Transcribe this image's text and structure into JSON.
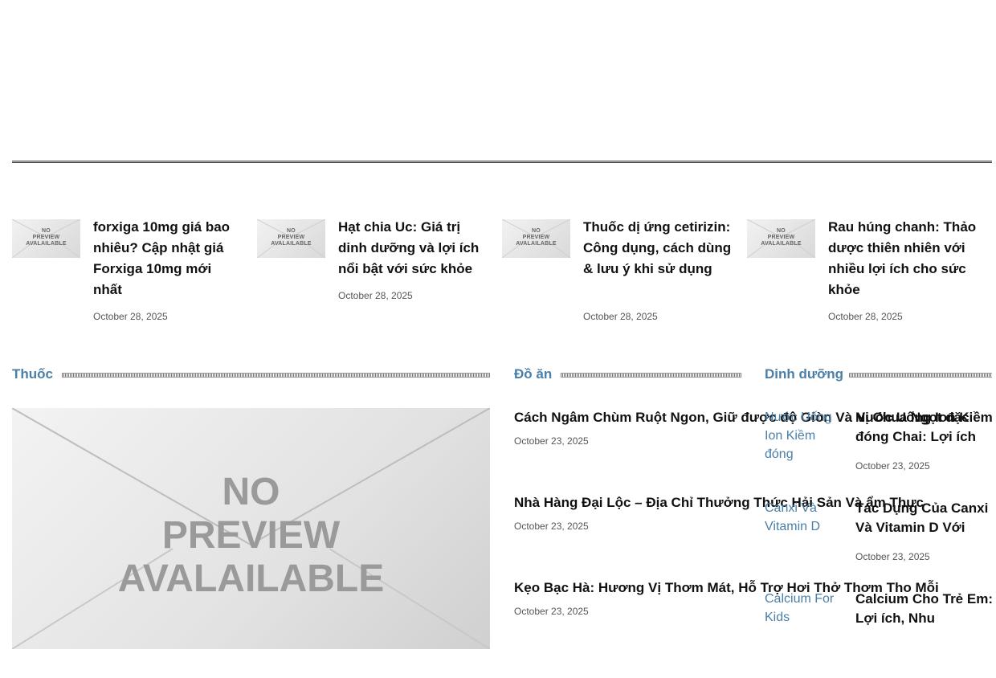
{
  "thumb_text": "NO PREVIEW AVALAILABLE",
  "big_image_text": "NO PREVIEW AVALAILABLE",
  "top_articles": [
    {
      "title": "forxiga 10mg giá bao nhiêu? Cập nhật giá Forxiga 10mg mới nhất",
      "date": "October 28, 2025"
    },
    {
      "title": "Hạt chia Uc: Giá trị dinh dưỡng và lợi ích nổi bật với sức khỏe",
      "date": "October 28, 2025"
    },
    {
      "title": "Thuốc dị ứng cetirizin: Công dụng, cách dùng & lưu ý khi sử dụng",
      "date": "October 28, 2025"
    },
    {
      "title": "Rau húng chanh: Thảo dược thiên nhiên với nhiều lợi ích cho sức khỏe",
      "date": "October 28, 2025"
    }
  ],
  "sections": {
    "thuoc": {
      "title": "Thuốc"
    },
    "do_an": {
      "title": "Đồ ăn"
    },
    "dinh_duong": {
      "title": "Dinh dưỡng"
    }
  },
  "do_an_articles": [
    {
      "title": "Cách Ngâm Chùm Ruột Ngon, Giữ được độ Giòn Và Vị Chua Ngọt đặc",
      "date": "October 23, 2025"
    },
    {
      "title": "Nhà Hàng Đại Lộc – Địa Chỉ Thưởng Thức Hải Sản Và ẩm Thực",
      "date": "October 23, 2025"
    },
    {
      "title": "Kẹo Bạc Hà: Hương Vị Thơm Mát, Hỗ Trợ Hơi Thở Thơm Tho Mỗi",
      "date": "October 23, 2025"
    }
  ],
  "dinh_duong_articles": [
    {
      "img_alt": "Nước Uống Ion Kiềm đóng",
      "title": "Nước Uống Ion Kiềm đóng Chai: Lợi ích",
      "date": "October 23, 2025"
    },
    {
      "img_alt": "Canxi Và Vitamin D",
      "title": "Tác Dụng Của Canxi Và Vitamin D Với",
      "date": "October 23, 2025"
    },
    {
      "img_alt": "Calcium For Kids",
      "title": "Calcium Cho Trẻ Em: Lợi ích, Nhu",
      "date": ""
    }
  ]
}
